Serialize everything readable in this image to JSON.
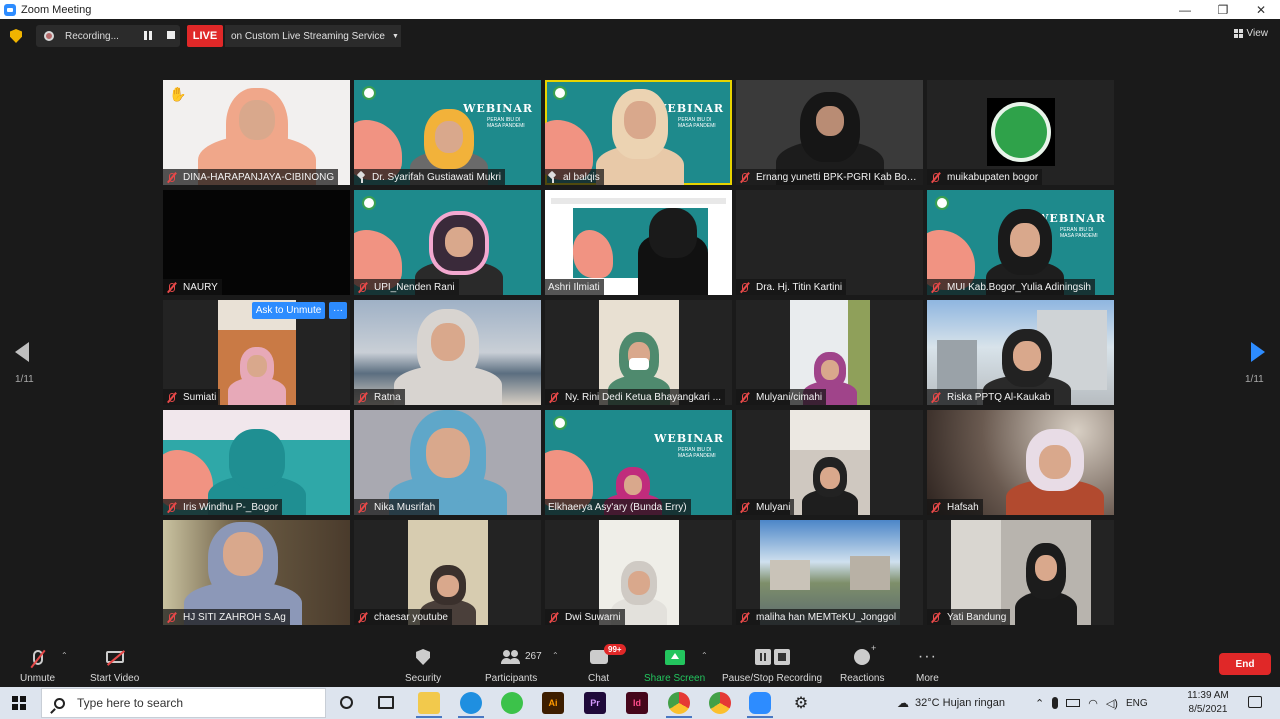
{
  "window": {
    "title": "Zoom Meeting",
    "controls": {
      "minimize": "—",
      "maximize": "❐",
      "close": "✕"
    }
  },
  "topbar": {
    "recording_label": "Recording...",
    "live_label": "LIVE",
    "live_service": "on Custom Live Streaming Service",
    "view_label": "View"
  },
  "colors": {
    "accent": "#2d8cff",
    "live_red": "#e02828",
    "muted_red": "#e54848",
    "share_green": "#23c55e",
    "active_speaker": "#e8d400",
    "webinar_teal": "#1e8a8c"
  },
  "grid": {
    "ask_unmute_label": "Ask to Unmute",
    "ask_more_label": "···",
    "participants": [
      {
        "name": "DINA-HARAPANJAYA-CIBINONG",
        "icon": "muted-mic-icon",
        "hand_raised": true
      },
      {
        "name": "Dr. Syarifah Gustiawati Mukri",
        "icon": "pin-icon"
      },
      {
        "name": "al balqis",
        "icon": "pin-icon",
        "active_speaker": true
      },
      {
        "name": "Ernang yunetti BPK-PGRI Kab Bogor",
        "icon": "muted-mic-icon"
      },
      {
        "name": "muikabupaten bogor",
        "icon": "muted-mic-icon"
      },
      {
        "name": "NAURY",
        "icon": "muted-mic-icon"
      },
      {
        "name": "UPI_Nenden Rani",
        "icon": "muted-mic-icon"
      },
      {
        "name": "Ashri Ilmiati",
        "icon": "none"
      },
      {
        "name": "Dra. Hj. Titin Kartini",
        "icon": "muted-mic-icon"
      },
      {
        "name": "MUI Kab.Bogor_Yulia Adiningsih",
        "icon": "muted-mic-icon"
      },
      {
        "name": "Sumiati",
        "icon": "muted-mic-icon"
      },
      {
        "name": "Ratna",
        "icon": "muted-mic-icon"
      },
      {
        "name": "Ny.  Rini Dedi Ketua Bhayangkari ...",
        "icon": "muted-mic-icon"
      },
      {
        "name": "Mulyani/cimahi",
        "icon": "muted-mic-icon"
      },
      {
        "name": "Riska PPTQ Al-Kaukab",
        "icon": "muted-mic-icon"
      },
      {
        "name": "Iris Windhu P-_Bogor",
        "icon": "muted-mic-icon"
      },
      {
        "name": "Nika Musrifah",
        "icon": "muted-mic-icon"
      },
      {
        "name": "Elkhaerya Asy'ary (Bunda Erry)",
        "icon": "none"
      },
      {
        "name": "Mulyani",
        "icon": "muted-mic-icon"
      },
      {
        "name": "Hafsah",
        "icon": "muted-mic-icon"
      },
      {
        "name": "HJ SITI ZAHROH S.Ag",
        "icon": "muted-mic-icon"
      },
      {
        "name": "chaesar youtube",
        "icon": "muted-mic-icon"
      },
      {
        "name": "Dwi Suwarni",
        "icon": "muted-mic-icon"
      },
      {
        "name": "maliha han MEMTeKU_Jonggol",
        "icon": "muted-mic-icon"
      },
      {
        "name": "Yati Bandung",
        "icon": "muted-mic-icon"
      }
    ],
    "webinar": {
      "title": "WEBINAR",
      "subtitle": "PERAN IBU DI MASA PANDEMI"
    }
  },
  "pagination": {
    "left": "1/11",
    "right": "1/11"
  },
  "toolbar": {
    "unmute": "Unmute",
    "start_video": "Start Video",
    "security": "Security",
    "participants": "Participants",
    "participants_count": "267",
    "chat": "Chat",
    "chat_badge": "99+",
    "share_screen": "Share Screen",
    "pause_stop_recording": "Pause/Stop Recording",
    "reactions": "Reactions",
    "more": "More",
    "end": "End"
  },
  "taskbar": {
    "search_placeholder": "Type here to search",
    "apps": [
      {
        "name": "file-explorer-icon",
        "label": ""
      },
      {
        "name": "edge-icon",
        "label": ""
      },
      {
        "name": "green-app-icon",
        "label": ""
      },
      {
        "name": "illustrator-icon",
        "label": "Ai"
      },
      {
        "name": "premiere-icon",
        "label": "Pr"
      },
      {
        "name": "indesign-icon",
        "label": "Id"
      },
      {
        "name": "chrome-icon",
        "label": ""
      },
      {
        "name": "chrome-icon-2",
        "label": ""
      },
      {
        "name": "zoom-icon",
        "label": ""
      },
      {
        "name": "settings-icon",
        "label": ""
      }
    ],
    "weather": "32°C  Hujan ringan",
    "language": "ENG",
    "time": "11:39 AM",
    "date": "8/5/2021"
  }
}
